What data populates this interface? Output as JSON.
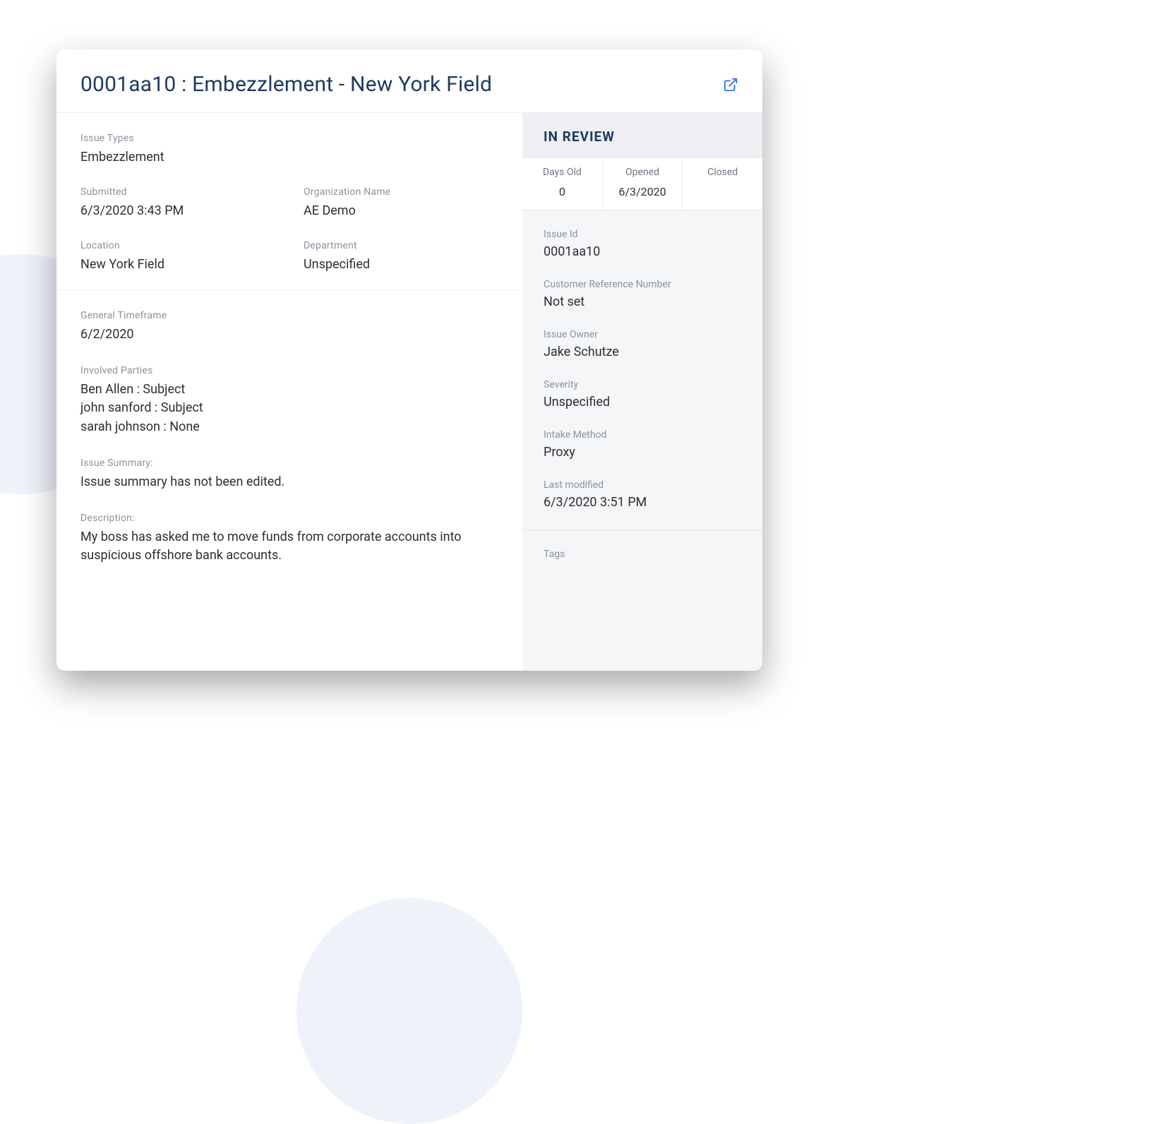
{
  "header": {
    "title": "0001aa10 : Embezzlement - New York Field"
  },
  "left": {
    "issueTypes": {
      "label": "Issue Types",
      "value": "Embezzlement"
    },
    "submitted": {
      "label": "Submitted",
      "value": "6/3/2020 3:43 PM"
    },
    "orgName": {
      "label": "Organization Name",
      "value": "AE Demo"
    },
    "location": {
      "label": "Location",
      "value": "New York Field"
    },
    "department": {
      "label": "Department",
      "value": "Unspecified"
    },
    "timeframe": {
      "label": "General Timeframe",
      "value": "6/2/2020"
    },
    "involvedParties": {
      "label": "Involved Parties",
      "items": [
        "Ben Allen : Subject",
        "john sanford : Subject",
        "sarah johnson : None"
      ]
    },
    "summary": {
      "label": "Issue Summary:",
      "value": "Issue summary has not been edited."
    },
    "description": {
      "label": "Description:",
      "value": "My boss has asked me to move funds from corporate accounts into suspicious offshore bank accounts."
    }
  },
  "right": {
    "status": "IN REVIEW",
    "stats": {
      "daysOld": {
        "label": "Days Old",
        "value": "0"
      },
      "opened": {
        "label": "Opened",
        "value": "6/3/2020"
      },
      "closed": {
        "label": "Closed",
        "value": ""
      }
    },
    "issueId": {
      "label": "Issue Id",
      "value": "0001aa10"
    },
    "customerRef": {
      "label": "Customer Reference Number",
      "value": "Not set"
    },
    "owner": {
      "label": "Issue Owner",
      "value": "Jake Schutze"
    },
    "severity": {
      "label": "Severity",
      "value": "Unspecified"
    },
    "intake": {
      "label": "Intake Method",
      "value": "Proxy"
    },
    "lastModified": {
      "label": "Last modified",
      "value": "6/3/2020 3:51 PM"
    },
    "tags": {
      "label": "Tags"
    }
  }
}
